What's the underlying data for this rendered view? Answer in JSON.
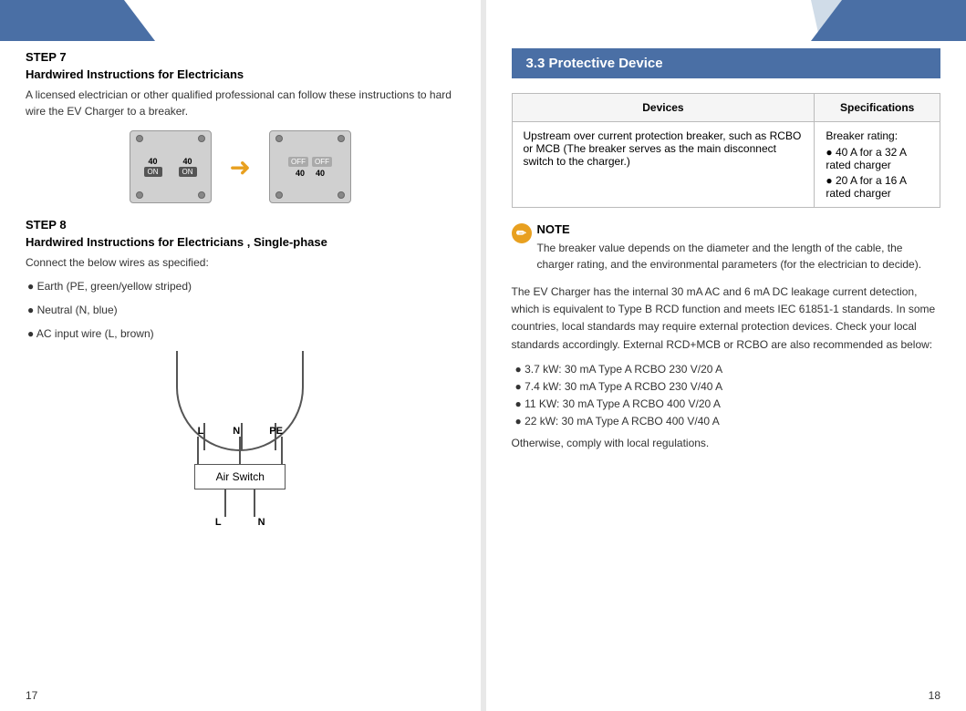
{
  "leftPage": {
    "number": "17",
    "step7": {
      "title": "STEP 7",
      "subtitle": "Hardwired Instructions for Electricians",
      "text": "A licensed electrician or other qualified professional can follow these instructions to hard wire the EV Charger to a breaker."
    },
    "step8": {
      "title": "STEP 8",
      "subtitle": "Hardwired Instructions for Electricians , Single-phase",
      "connectText": "Connect the below wires as specified:",
      "bullets": [
        "● Earth (PE, green/yellow striped)",
        "● Neutral (N, blue)",
        "● AC input wire (L, brown)"
      ]
    },
    "breaker1": {
      "number1": "40",
      "number2": "40",
      "label1": "ON",
      "label2": "ON"
    },
    "breaker2": {
      "label1": "OFF",
      "label2": "OFF",
      "number1": "40",
      "number2": "40"
    },
    "wiring": {
      "topLabels": [
        "L",
        "N",
        "PE"
      ],
      "airSwitchLabel": "Air Switch",
      "bottomLabels": [
        "L",
        "N"
      ]
    }
  },
  "rightPage": {
    "number": "18",
    "sectionTitle": "3.3 Protective Device",
    "table": {
      "headers": [
        "Devices",
        "Specifications"
      ],
      "rows": [
        {
          "device": "Upstream over current protection breaker, such as RCBO or MCB (The breaker serves as the main disconnect switch to the charger.)",
          "specs": {
            "label": "Breaker rating:",
            "bullets": [
              "● 40 A for a 32 A rated charger",
              "● 20 A for a 16 A rated charger"
            ]
          }
        }
      ]
    },
    "note": {
      "title": "NOTE",
      "text": "The breaker value depends on the diameter and the length of the cable, the charger rating, and the environmental parameters (for the electrician to decide)."
    },
    "bodyText1": "The EV Charger has the internal 30 mA AC and 6 mA DC leakage current detection, which is equivalent to Type B RCD function and meets IEC 61851-1 standards. In some countries, local standards may require external protection devices. Check your local standards accordingly. External RCD+MCB or RCBO are also recommended as below:",
    "bullets": [
      "● 3.7 kW: 30 mA Type A RCBO 230 V/20 A",
      "● 7.4 kW: 30 mA Type A RCBO 230 V/40 A",
      "● 11 KW: 30 mA Type A RCBO 400 V/20 A",
      "● 22 kW: 30 mA Type A RCBO 400 V/40 A"
    ],
    "bodyText2": "Otherwise, comply with local regulations."
  }
}
